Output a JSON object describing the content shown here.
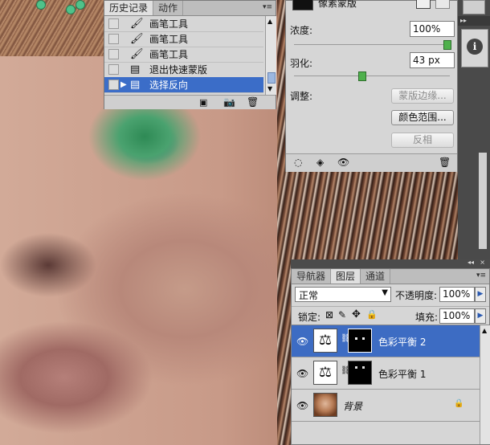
{
  "history_panel": {
    "tabs": [
      "历史记录",
      "动作"
    ],
    "menu_icon": "panel-menu-icon",
    "items": [
      {
        "label": "画笔工具",
        "icon": "brush-icon"
      },
      {
        "label": "画笔工具",
        "icon": "brush-icon"
      },
      {
        "label": "画笔工具",
        "icon": "brush-icon"
      },
      {
        "label": "退出快速蒙版",
        "icon": "history-state-icon"
      },
      {
        "label": "选择反向",
        "icon": "history-state-icon",
        "selected": true
      }
    ],
    "footer_icons": [
      "new-document-from-state-icon",
      "new-snapshot-icon",
      "delete-state-icon"
    ]
  },
  "mask_panel": {
    "top_label": "像素蒙版",
    "density_label": "浓度:",
    "density_value": "100%",
    "density_level": 1.0,
    "feather_label": "羽化:",
    "feather_value": "43 px",
    "feather_level": 0.43,
    "adjust_label": "调整:",
    "buttons": {
      "mask_edge": "蒙版边缘...",
      "color_range": "颜色范围...",
      "invert": "反相"
    },
    "footer_icons": [
      "load-selection-icon",
      "apply-mask-icon",
      "eye-icon",
      "delete-icon"
    ]
  },
  "info_button": {
    "icon": "info-icon",
    "glyph": "i"
  },
  "layers_panel": {
    "tabs": [
      "导航器",
      "图层",
      "通道"
    ],
    "blend_mode": "正常",
    "opacity_label": "不透明度:",
    "opacity_value": "100%",
    "lock_label": "锁定:",
    "fill_label": "填充:",
    "fill_value": "100%",
    "layers": [
      {
        "name": "色彩平衡 2",
        "selected": true
      },
      {
        "name": "色彩平衡 1",
        "selected": false
      },
      {
        "name": "背景",
        "selected": false
      }
    ]
  },
  "colors": {
    "selection": "#3b6dc8",
    "panel_bg": "#d6d6d6"
  }
}
